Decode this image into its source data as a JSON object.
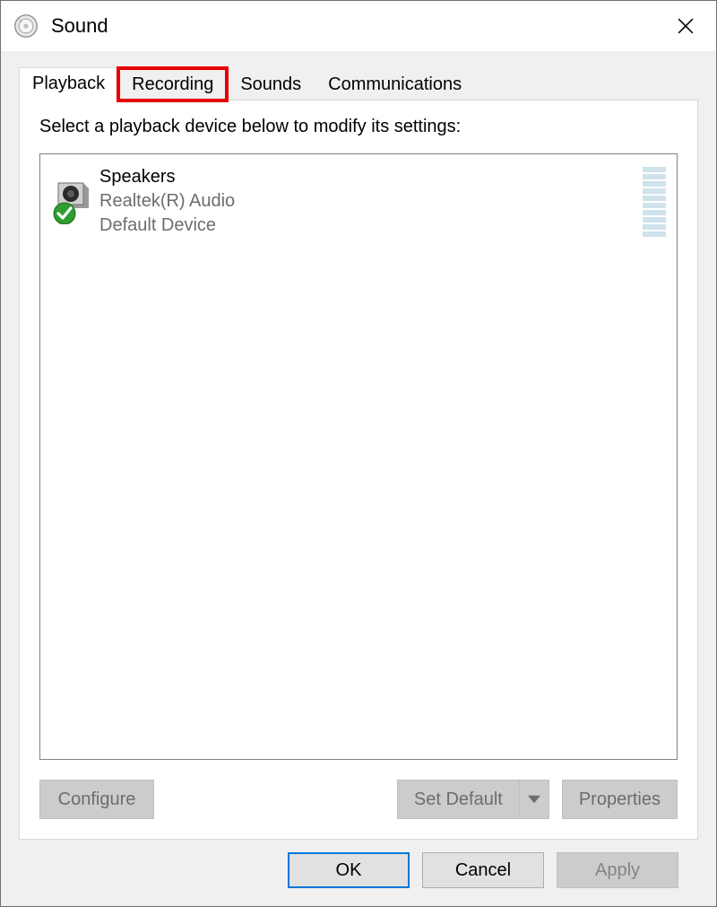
{
  "window": {
    "title": "Sound"
  },
  "tabs": [
    {
      "label": "Playback",
      "active": true
    },
    {
      "label": "Recording",
      "active": false,
      "highlighted": true
    },
    {
      "label": "Sounds",
      "active": false
    },
    {
      "label": "Communications",
      "active": false
    }
  ],
  "panel": {
    "instruction": "Select a playback device below to modify its settings:"
  },
  "devices": [
    {
      "name": "Speakers",
      "driver": "Realtek(R) Audio",
      "status": "Default Device"
    }
  ],
  "panel_buttons": {
    "configure": "Configure",
    "set_default": "Set Default",
    "properties": "Properties"
  },
  "dialog_buttons": {
    "ok": "OK",
    "cancel": "Cancel",
    "apply": "Apply"
  }
}
